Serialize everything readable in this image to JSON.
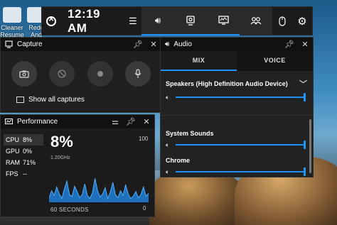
{
  "desktop": {
    "icons": [
      {
        "label": "Cleaner\nResume"
      },
      {
        "label": "Redu\nAnd"
      }
    ]
  },
  "gamebar": {
    "time": "12:19 AM",
    "accent": "#1e90ff",
    "icons": [
      "xbox-icon",
      "menu-icon",
      "audio-icon",
      "capture-icon",
      "performance-icon",
      "social-icon",
      "mouse-icon",
      "settings-icon"
    ]
  },
  "capture": {
    "title": "Capture",
    "show_all": "Show all captures"
  },
  "audio": {
    "title": "Audio",
    "tabs": [
      "MIX",
      "VOICE"
    ],
    "active_tab": "MIX",
    "device": "Speakers (High Definition Audio Device)",
    "device_volume": 1.0,
    "apps": [
      {
        "name": "System Sounds",
        "volume": 1.0
      },
      {
        "name": "Chrome",
        "volume": 1.0
      }
    ]
  },
  "performance": {
    "title": "Performance",
    "metrics": [
      {
        "name": "CPU",
        "value": "8%"
      },
      {
        "name": "GPU",
        "value": "0%"
      },
      {
        "name": "RAM",
        "value": "71%"
      },
      {
        "name": "FPS",
        "value": "--"
      }
    ],
    "selected_metric": "CPU",
    "big_value": "8%",
    "frequency": "1.20GHz",
    "y_max": "100",
    "y_min": "0",
    "x_label": "60 SECONDS",
    "graph_color": "#1e7fd8"
  },
  "chart_data": {
    "type": "area",
    "title": "",
    "xlabel": "60 SECONDS",
    "ylabel": "",
    "ylim": [
      0,
      100
    ],
    "values": [
      12,
      30,
      18,
      40,
      22,
      10,
      35,
      55,
      20,
      15,
      42,
      28,
      12,
      20,
      48,
      18,
      10,
      25,
      62,
      30,
      14,
      22,
      38,
      10,
      26,
      52,
      20,
      12,
      30,
      18,
      45,
      22,
      10,
      16,
      28,
      12,
      20,
      40,
      15,
      24
    ]
  }
}
